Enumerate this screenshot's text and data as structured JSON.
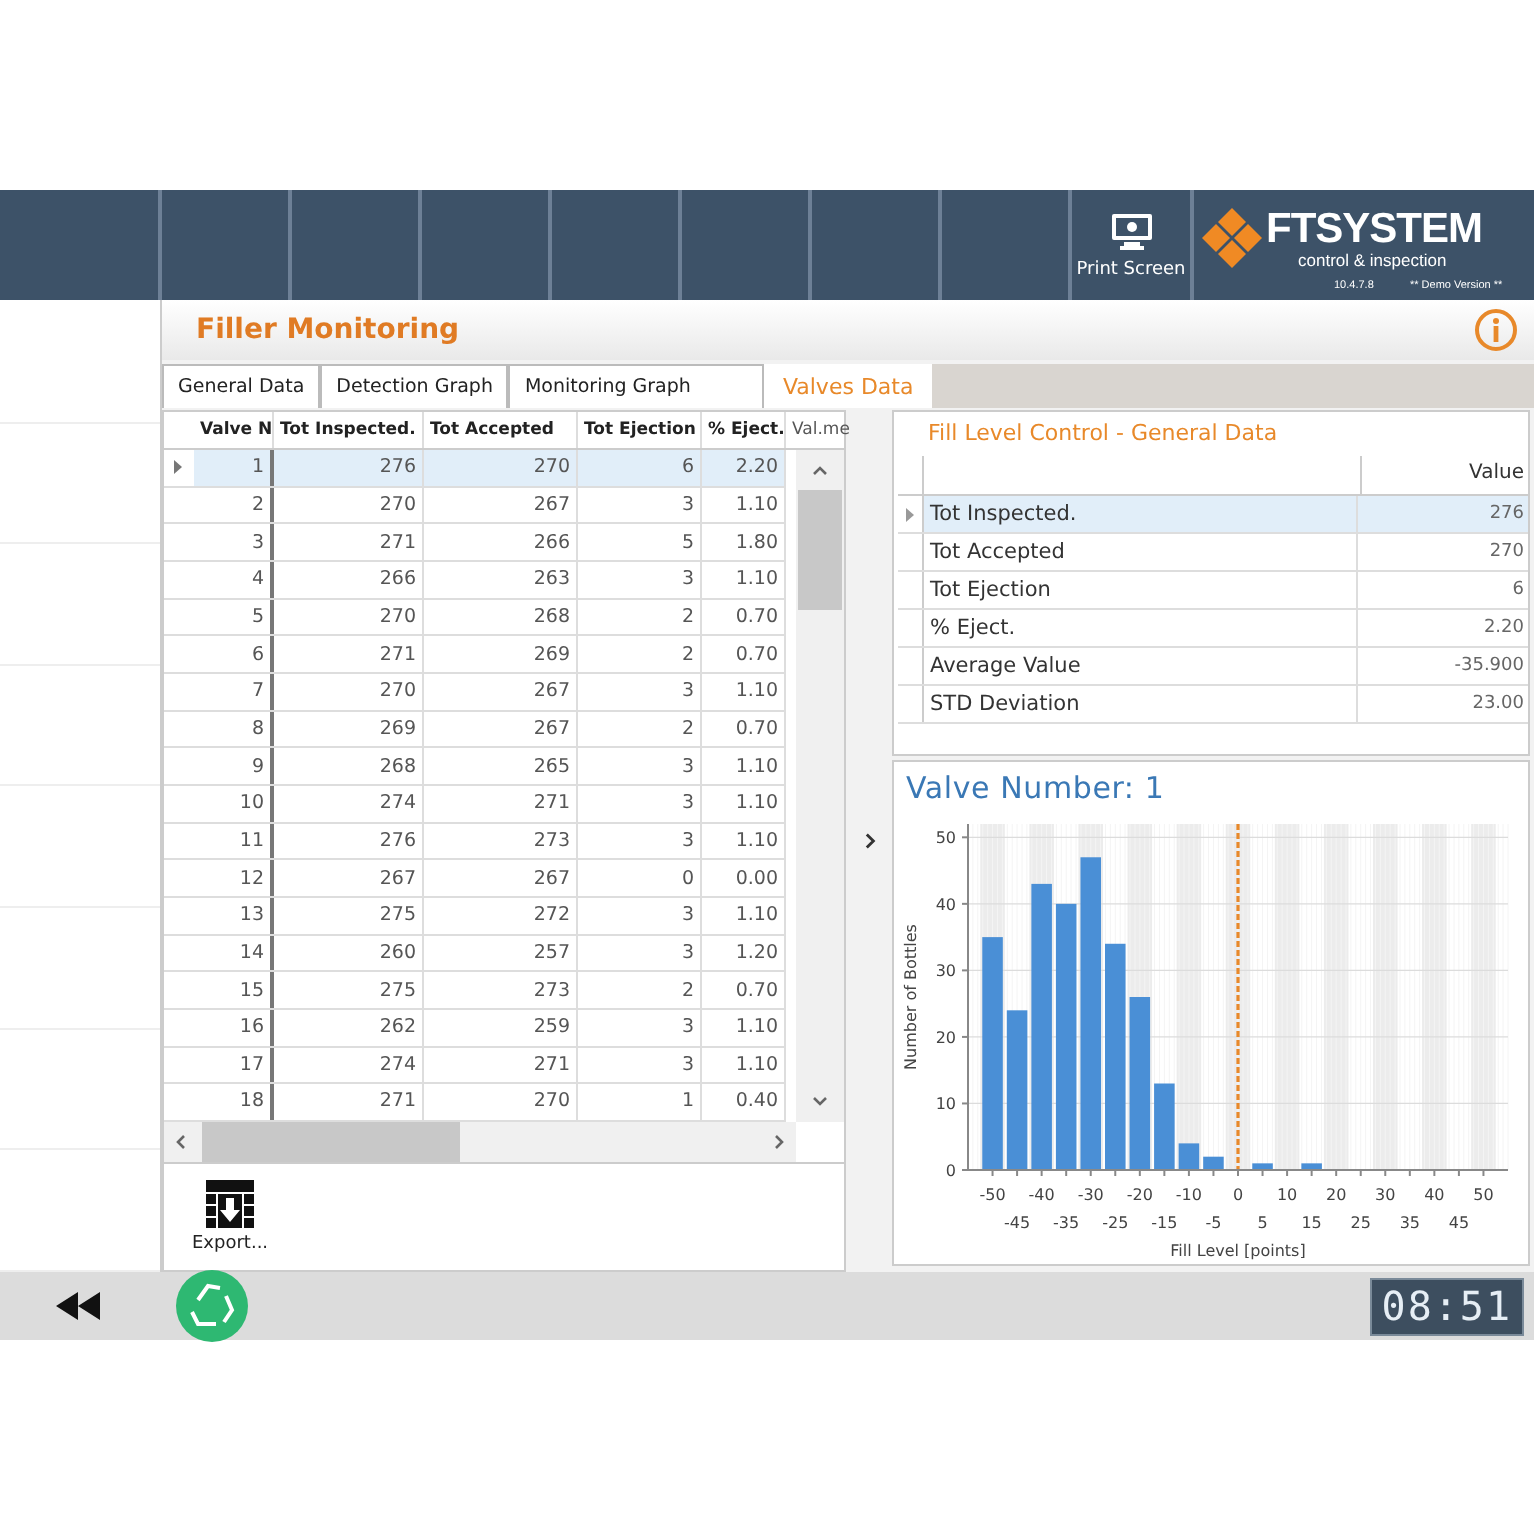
{
  "header": {
    "print_button": {
      "label": "Print Screen"
    },
    "logo": {
      "brand": "FTSYSTEM",
      "tagline": "control & inspection",
      "version": "10.4.7.8",
      "edition": "** Demo Version **"
    }
  },
  "page": {
    "title": "Filler Monitoring"
  },
  "tabs": [
    {
      "label": "General Data",
      "selected": false
    },
    {
      "label": "Detection Graph",
      "selected": false
    },
    {
      "label": "Monitoring Graph",
      "selected": false
    },
    {
      "label": "Valves Data",
      "selected": true
    }
  ],
  "valves_table": {
    "columns": [
      "Valve N",
      "Tot Inspected.",
      "Tot Accepted",
      "Tot Ejection",
      "% Eject.",
      "Val.me"
    ],
    "rows": [
      {
        "cells": [
          "1",
          "276",
          "270",
          "6",
          "2.20"
        ],
        "selected": true
      },
      {
        "cells": [
          "2",
          "270",
          "267",
          "3",
          "1.10"
        ],
        "selected": false
      },
      {
        "cells": [
          "3",
          "271",
          "266",
          "5",
          "1.80"
        ],
        "selected": false
      },
      {
        "cells": [
          "4",
          "266",
          "263",
          "3",
          "1.10"
        ],
        "selected": false
      },
      {
        "cells": [
          "5",
          "270",
          "268",
          "2",
          "0.70"
        ],
        "selected": false
      },
      {
        "cells": [
          "6",
          "271",
          "269",
          "2",
          "0.70"
        ],
        "selected": false
      },
      {
        "cells": [
          "7",
          "270",
          "267",
          "3",
          "1.10"
        ],
        "selected": false
      },
      {
        "cells": [
          "8",
          "269",
          "267",
          "2",
          "0.70"
        ],
        "selected": false
      },
      {
        "cells": [
          "9",
          "268",
          "265",
          "3",
          "1.10"
        ],
        "selected": false
      },
      {
        "cells": [
          "10",
          "274",
          "271",
          "3",
          "1.10"
        ],
        "selected": false
      },
      {
        "cells": [
          "11",
          "276",
          "273",
          "3",
          "1.10"
        ],
        "selected": false
      },
      {
        "cells": [
          "12",
          "267",
          "267",
          "0",
          "0.00"
        ],
        "selected": false
      },
      {
        "cells": [
          "13",
          "275",
          "272",
          "3",
          "1.10"
        ],
        "selected": false
      },
      {
        "cells": [
          "14",
          "260",
          "257",
          "3",
          "1.20"
        ],
        "selected": false
      },
      {
        "cells": [
          "15",
          "275",
          "273",
          "2",
          "0.70"
        ],
        "selected": false
      },
      {
        "cells": [
          "16",
          "262",
          "259",
          "3",
          "1.10"
        ],
        "selected": false
      },
      {
        "cells": [
          "17",
          "274",
          "271",
          "3",
          "1.10"
        ],
        "selected": false
      },
      {
        "cells": [
          "18",
          "271",
          "270",
          "1",
          "0.40"
        ],
        "selected": false
      }
    ]
  },
  "export_button": {
    "label": "Export..."
  },
  "summary": {
    "title": "Fill Level Control - General Data",
    "columns": [
      "Value"
    ],
    "rows": [
      {
        "label": "Tot Inspected.",
        "value": "276",
        "selected": true
      },
      {
        "label": "Tot Accepted",
        "value": "270",
        "selected": false
      },
      {
        "label": "Tot Ejection",
        "value": "6",
        "selected": false
      },
      {
        "label": "% Eject.",
        "value": "2.20",
        "selected": false
      },
      {
        "label": "Average Value",
        "value": "-35.900",
        "selected": false
      },
      {
        "label": "STD Deviation",
        "value": "23.00",
        "selected": false
      }
    ]
  },
  "chart_panel": {
    "title": "Valve Number: 1",
    "chart_data": {
      "type": "bar",
      "xlabel": "Fill Level [points]",
      "ylabel": "Number of Bottles",
      "x": [
        -50,
        -45,
        -40,
        -35,
        -30,
        -25,
        -20,
        -15,
        -10,
        -5,
        0,
        5,
        10,
        15
      ],
      "series": [
        {
          "color": "#4a8fd6",
          "values": [
            35,
            24,
            43,
            40,
            47,
            34,
            26,
            13,
            4,
            2,
            0,
            1,
            0,
            1
          ]
        }
      ],
      "xlim": [
        -55,
        55
      ],
      "ylim": [
        0,
        52
      ],
      "xticks": [
        -50,
        -40,
        -30,
        -20,
        -10,
        0,
        10,
        20,
        30,
        40,
        50
      ],
      "annotations": [
        "-45",
        "-35",
        "-25",
        "-15",
        "-5",
        "5",
        "15",
        "25",
        "35",
        "45"
      ],
      "yticks": [
        0,
        10,
        20,
        30,
        40,
        50
      ],
      "grid": true,
      "bands": [
        {
          "axis": "x",
          "from": -52.5,
          "to": -47.5,
          "color": "#ececec"
        },
        {
          "axis": "x",
          "from": -42.5,
          "to": -37.5,
          "color": "#ececec"
        },
        {
          "axis": "x",
          "from": -32.5,
          "to": -27.5,
          "color": "#ececec"
        },
        {
          "axis": "x",
          "from": -22.5,
          "to": -17.5,
          "color": "#ececec"
        },
        {
          "axis": "x",
          "from": -12.5,
          "to": -7.5,
          "color": "#ececec"
        },
        {
          "axis": "x",
          "from": -2.5,
          "to": 2.5,
          "color": "#ececec"
        },
        {
          "axis": "x",
          "from": 7.5,
          "to": 12.5,
          "color": "#ececec"
        },
        {
          "axis": "x",
          "from": 17.5,
          "to": 22.5,
          "color": "#ececec"
        },
        {
          "axis": "x",
          "from": 27.5,
          "to": 32.5,
          "color": "#ececec"
        },
        {
          "axis": "x",
          "from": 37.5,
          "to": 42.5,
          "color": "#ececec"
        },
        {
          "axis": "x",
          "from": 47.5,
          "to": 52.5,
          "color": "#ececec"
        }
      ],
      "ref_lines": [
        {
          "axis": "x",
          "value": 0,
          "color": "#e8892a"
        }
      ]
    }
  },
  "footer": {
    "clock": "08:51"
  }
}
